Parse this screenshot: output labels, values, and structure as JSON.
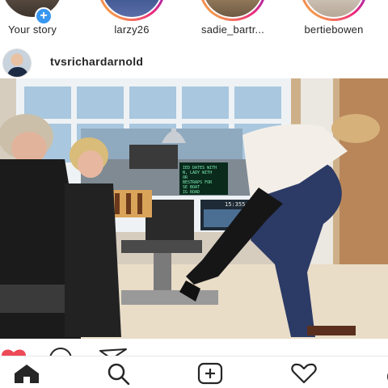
{
  "stories": [
    {
      "label": "Your story",
      "has_add_badge": true
    },
    {
      "label": "larzy26"
    },
    {
      "label": "sadie_bartr..."
    },
    {
      "label": "bertiebowen"
    }
  ],
  "post": {
    "username": "tvsrichardarnold",
    "teleprompter_lines": [
      "IED DATES WITH",
      "N, LADY WITH",
      "OR",
      "BESTRAPS FOR",
      "SE BOAT",
      "IG ROAD"
    ],
    "screen_readout": "15:355"
  },
  "colors": {
    "accent_blue": "#3897f0",
    "like_red": "#ed4956",
    "story_ring_start": "#f9ce34",
    "story_ring_end": "#6228d7"
  },
  "icons": {
    "nav": [
      "home-icon",
      "search-icon",
      "add-post-icon",
      "activity-heart-icon",
      "profile-icon"
    ],
    "actions": [
      "like-heart-icon",
      "comment-icon",
      "share-icon"
    ]
  }
}
